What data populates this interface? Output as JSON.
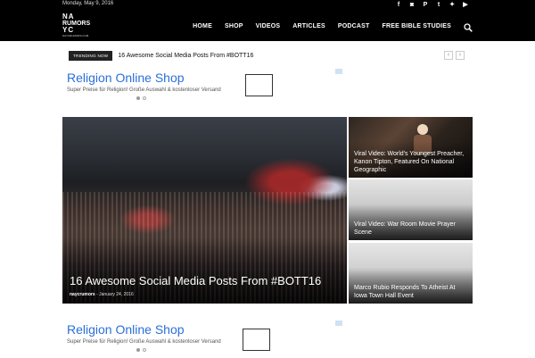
{
  "topbar": {
    "date": "Monday, May 9, 2016",
    "social_icons": [
      "facebook-icon",
      "instagram-icon",
      "pinterest-icon",
      "tumblr-icon",
      "twitter-icon",
      "youtube-icon"
    ]
  },
  "header": {
    "logo": {
      "line1": "NA",
      "line2": "RUMORS",
      "line3": "YC",
      "line4": "NAYCRUMORS.COM"
    },
    "nav": [
      "HOME",
      "SHOP",
      "VIDEOS",
      "ARTICLES",
      "PODCAST",
      "FREE BIBLE STUDIES"
    ]
  },
  "trending": {
    "badge": "TRENDING NOW",
    "headline": "16 Awesome Social Media Posts From #BOTT16"
  },
  "ad": {
    "title": "Religion Online Shop",
    "description": "Super Preise für Religion! Große Auswahl & kostenloser Versand"
  },
  "featured": {
    "main": {
      "title": "16 Awesome Social Media Posts From #BOTT16",
      "author": "naycrumors",
      "date": "January 24, 2016"
    },
    "side": [
      {
        "title": "Viral Video: World's Youngest Preacher, Kanon Tipton, Featured On National Geographic"
      },
      {
        "title": "Viral Video: War Room Movie Prayer Scene"
      },
      {
        "title": "Marco Rubio Responds To Atheist At Iowa Town Hall Event"
      }
    ]
  },
  "colors": {
    "ad_link": "#2a6fdb",
    "header_bg": "#000000"
  }
}
